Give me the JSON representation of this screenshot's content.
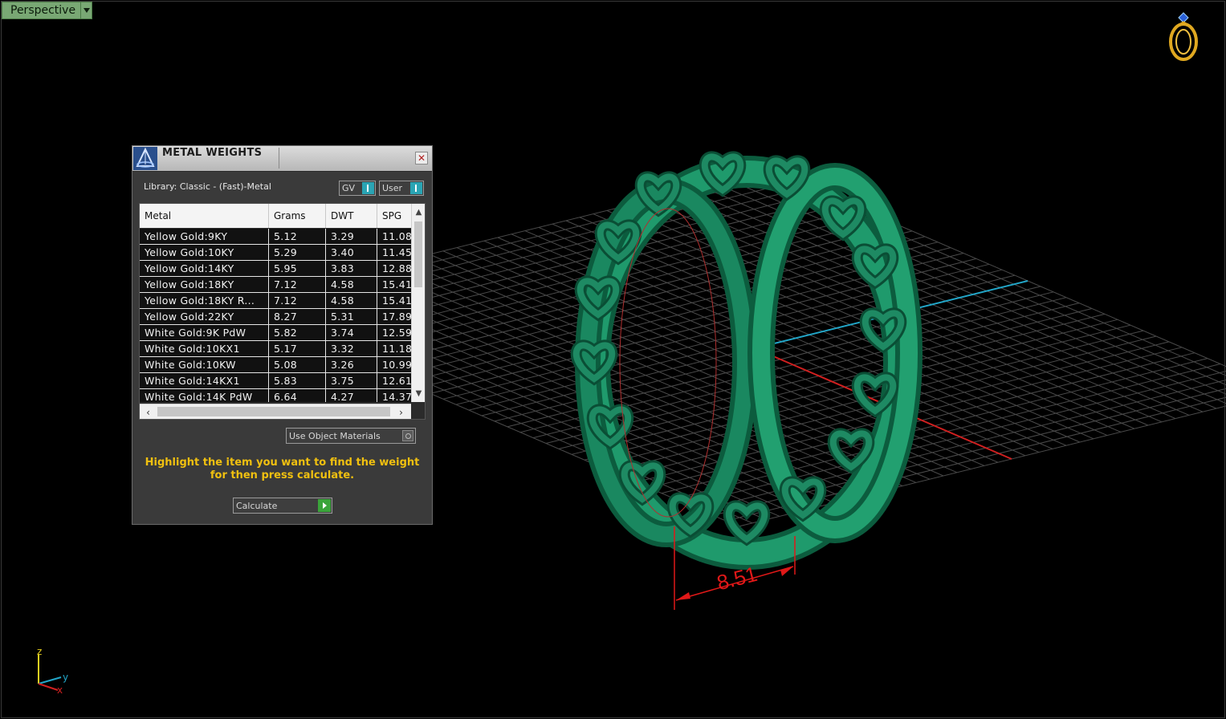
{
  "viewport": {
    "view_name": "Perspective",
    "dimension_value": "8.51",
    "axes": {
      "z": "z",
      "y": "y",
      "x": "x"
    },
    "model_color": "#1e8a63"
  },
  "dialog": {
    "title": "METAL WEIGHTS",
    "close_glyph": "✕",
    "library_label": "Library: Classic - (Fast)-Metal",
    "gv_label": "GV",
    "user_label": "User",
    "columns": [
      "Metal",
      "Grams",
      "DWT",
      "SPG"
    ],
    "rows": [
      [
        "Yellow Gold:9KY",
        "5.12",
        "3.29",
        "11.08"
      ],
      [
        "Yellow Gold:10KY",
        "5.29",
        "3.40",
        "11.45"
      ],
      [
        "Yellow Gold:14KY",
        "5.95",
        "3.83",
        "12.88"
      ],
      [
        "Yellow Gold:18KY",
        "7.12",
        "4.58",
        "15.41"
      ],
      [
        "Yellow Gold:18KY R...",
        "7.12",
        "4.58",
        "15.41"
      ],
      [
        "Yellow Gold:22KY",
        "8.27",
        "5.31",
        "17.89"
      ],
      [
        "White Gold:9K PdW",
        "5.82",
        "3.74",
        "12.59"
      ],
      [
        "White Gold:10KX1",
        "5.17",
        "3.32",
        "11.18"
      ],
      [
        "White Gold:10KW",
        "5.08",
        "3.26",
        "10.99"
      ],
      [
        "White Gold:14KX1",
        "5.83",
        "3.75",
        "12.61"
      ],
      [
        "White Gold:14K PdW",
        "6.64",
        "4.27",
        "14.37"
      ]
    ],
    "use_object_materials_label": "Use Object Materials",
    "hint": "Highlight the item you want to find the weight for then press calculate.",
    "calculate_label": "Calculate",
    "accent_color": "#2aa4b4",
    "hint_color": "#f0c010"
  }
}
